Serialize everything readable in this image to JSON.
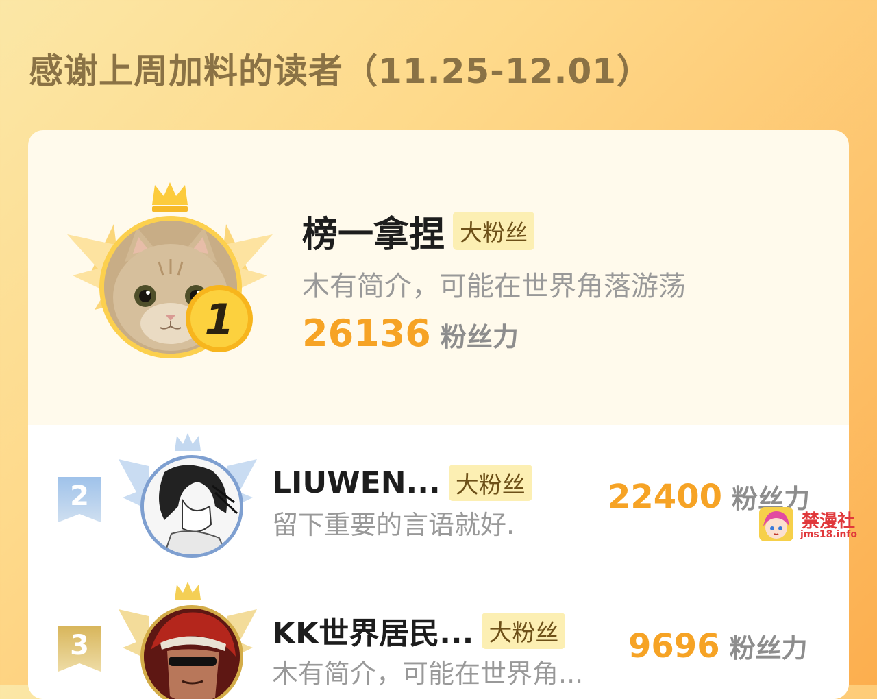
{
  "page": {
    "title": "感谢上周加料的读者（11.25-12.01）"
  },
  "ranking": [
    {
      "rank": "1",
      "name": "榜一拿捏",
      "badge": "大粉丝",
      "bio": "木有简介，可能在世界角落游荡",
      "score": "26136",
      "score_unit": "粉丝力",
      "avatar": "cat-avatar",
      "accent": "#fcd04e"
    },
    {
      "rank": "2",
      "name": "LIUWEN...",
      "badge": "大粉丝",
      "bio": "留下重要的言语就好.",
      "score": "22400",
      "score_unit": "粉丝力",
      "avatar": "manga-sketch-avatar",
      "accent": "#7e9fd0"
    },
    {
      "rank": "3",
      "name": "KK世界居民...",
      "badge": "大粉丝",
      "bio": "木有简介，可能在世界角...",
      "score": "9696",
      "score_unit": "粉丝力",
      "avatar": "sunglasses-character-avatar",
      "accent": "#d3ac48"
    }
  ],
  "watermark": {
    "title": "禁漫社",
    "url": "jms18.info",
    "icon": "anime-girl-icon"
  },
  "colors": {
    "score": "#f6a325",
    "badge_bg": "#fcefb3",
    "badge_text": "#6d5018",
    "title": "#8a7245"
  }
}
